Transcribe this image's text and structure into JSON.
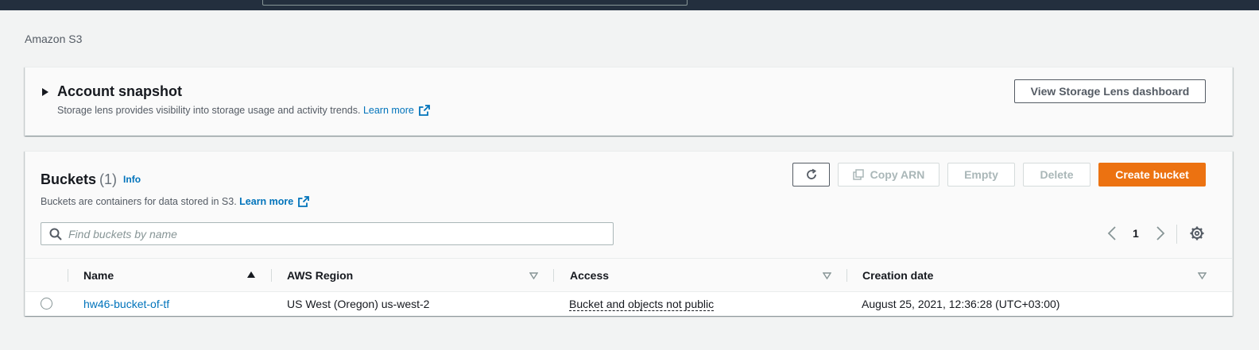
{
  "breadcrumb": "Amazon S3",
  "snapshot": {
    "title": "Account snapshot",
    "description": "Storage lens provides visibility into storage usage and activity trends.",
    "learn_more": "Learn more",
    "lens_button": "View Storage Lens dashboard"
  },
  "buckets": {
    "title": "Buckets",
    "count": "(1)",
    "info": "Info",
    "description": "Buckets are containers for data stored in S3.",
    "learn_more": "Learn more",
    "buttons": {
      "copy_arn": "Copy ARN",
      "empty": "Empty",
      "delete": "Delete",
      "create": "Create bucket"
    },
    "search": {
      "placeholder": "Find buckets by name",
      "value": ""
    },
    "pagination": {
      "current_page": "1"
    },
    "columns": [
      "Name",
      "AWS Region",
      "Access",
      "Creation date"
    ],
    "rows": [
      {
        "name": "hw46-bucket-of-tf",
        "region": "US West (Oregon) us-west-2",
        "access": "Bucket and objects not public",
        "creation_date": "August 25, 2021, 12:36:28 (UTC+03:00)"
      }
    ]
  },
  "icons": {
    "refresh": "refresh-icon",
    "copy": "copy-icon",
    "search": "search-icon",
    "settings": "gear-icon",
    "external": "external-link-icon"
  },
  "colors": {
    "topbar": "#232f3e",
    "link": "#0073bb",
    "primary": "#ec7211",
    "background": "#f2f3f3"
  }
}
